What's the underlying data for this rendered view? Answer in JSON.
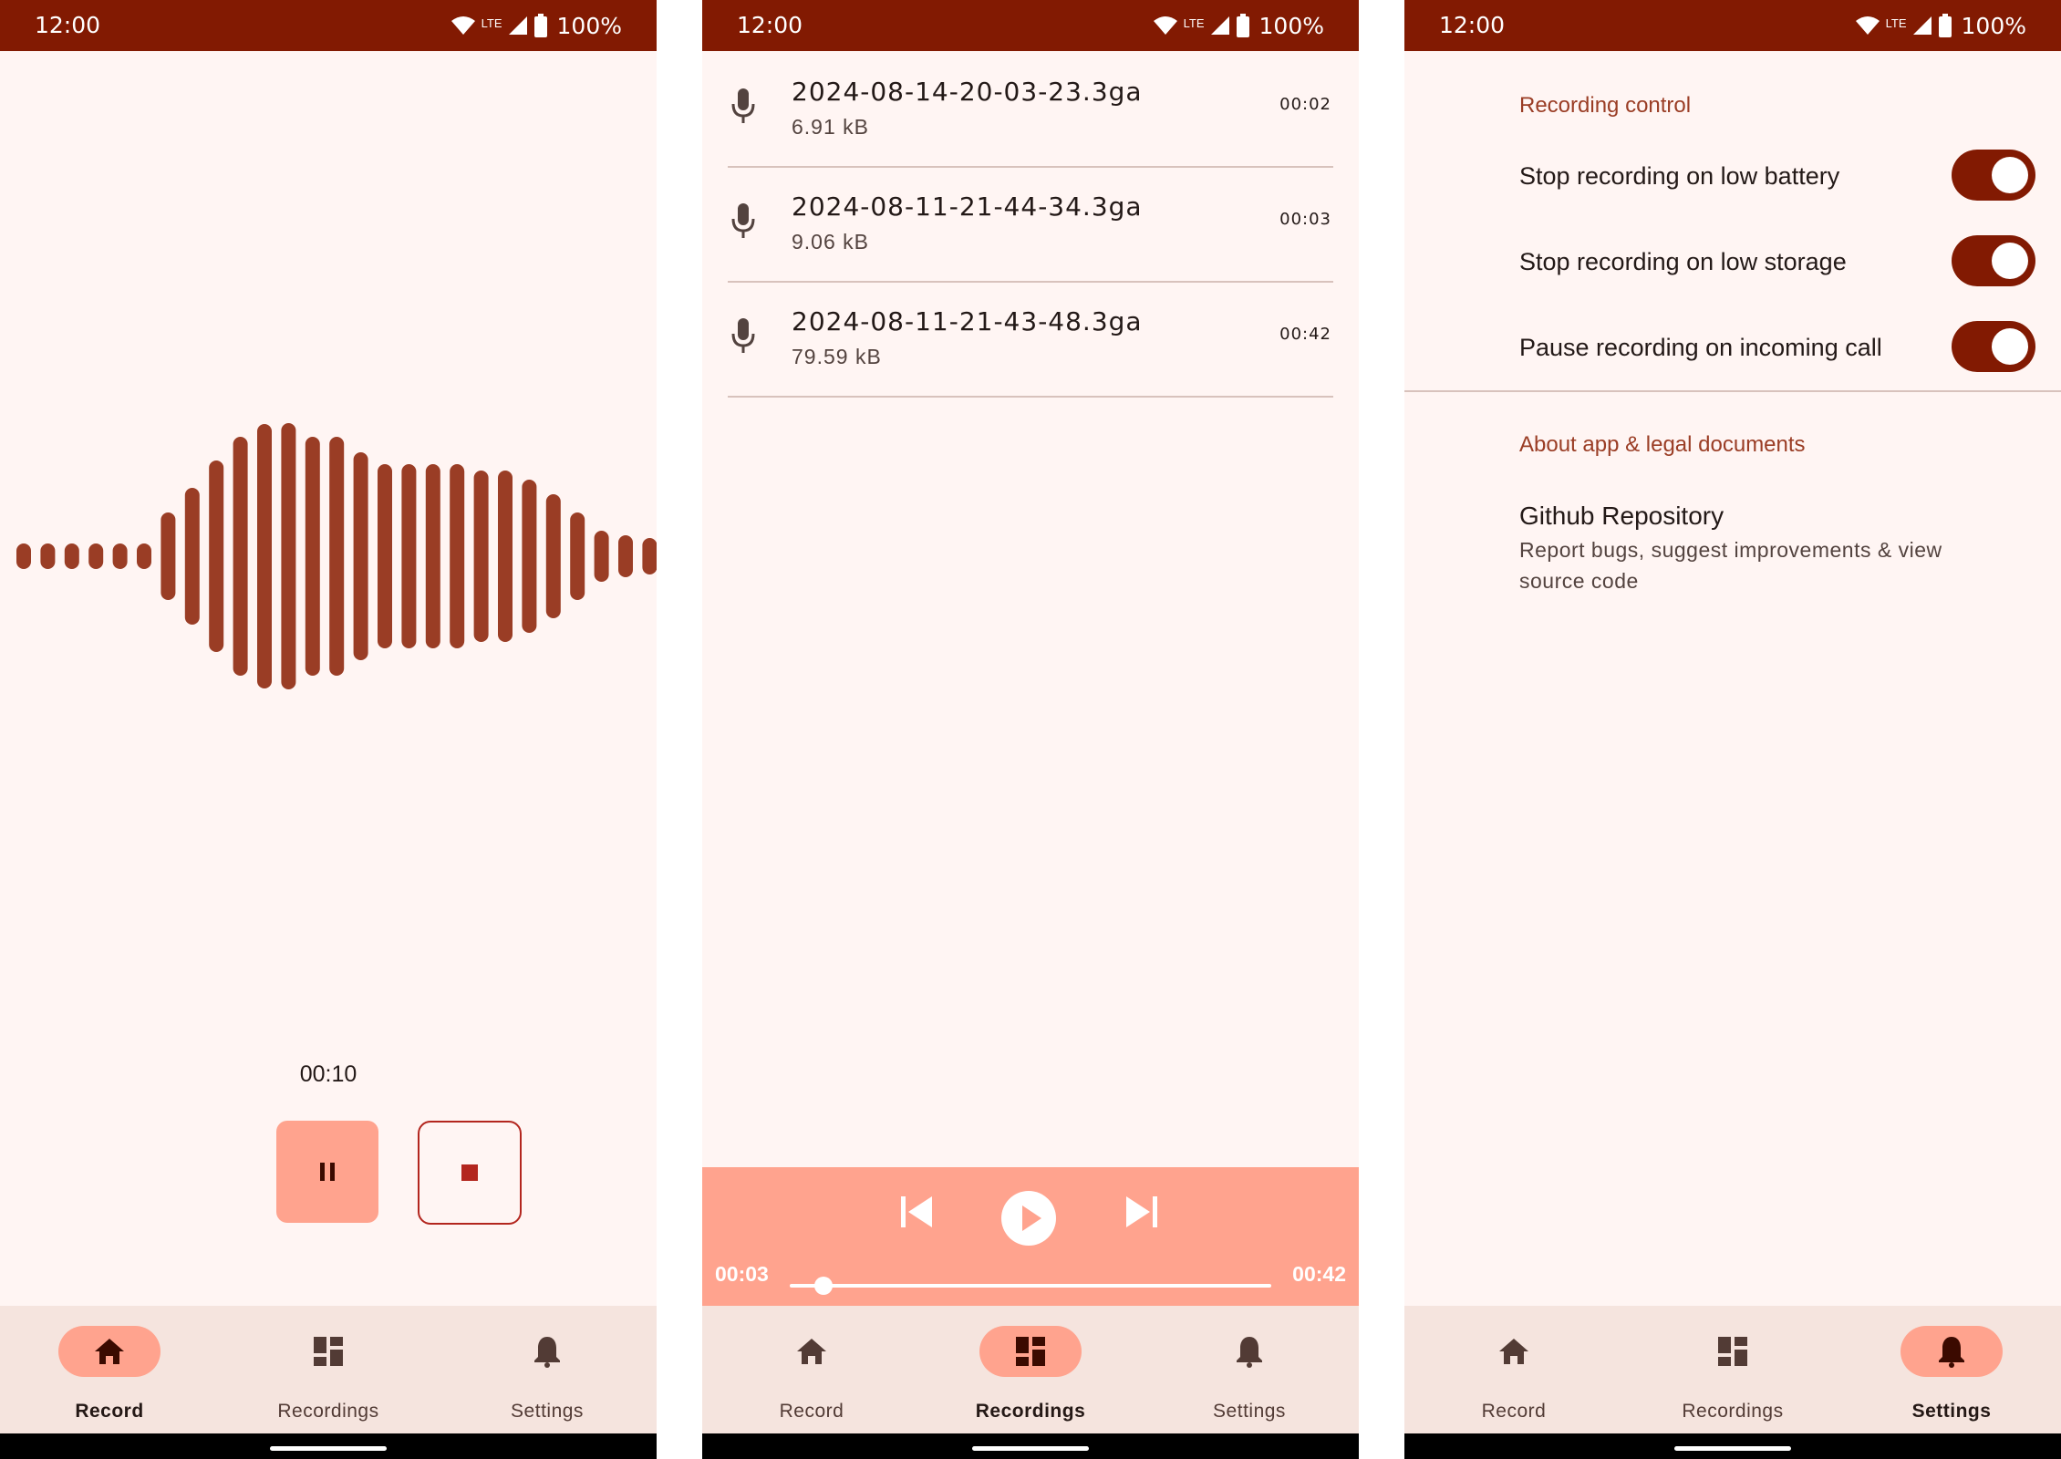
{
  "status_bar": {
    "time": "12:00",
    "network": "LTE",
    "battery": "100%"
  },
  "nav": {
    "record": "Record",
    "recordings": "Recordings",
    "settings": "Settings"
  },
  "record_screen": {
    "timer": "00:10"
  },
  "recordings_screen": {
    "items": [
      {
        "name": "2024-08-14-20-03-23.3ga",
        "size": "6.91 kB",
        "duration": "00:02"
      },
      {
        "name": "2024-08-11-21-44-34.3ga",
        "size": "9.06 kB",
        "duration": "00:03"
      },
      {
        "name": "2024-08-11-21-43-48.3ga",
        "size": "79.59 kB",
        "duration": "00:42"
      }
    ],
    "player": {
      "current": "00:03",
      "total": "00:42",
      "progress": 0.07
    }
  },
  "settings_screen": {
    "section_recording": "Recording control",
    "low_battery": "Stop recording on low battery",
    "low_storage": "Stop recording on low storage",
    "incoming_call": "Pause recording on incoming call",
    "section_about": "About app & legal documents",
    "github_title": "Github Repository",
    "github_sub": "Report bugs, suggest improvements & view source code",
    "toggles": {
      "low_battery": true,
      "low_storage": true,
      "incoming_call": true
    }
  },
  "colors": {
    "primary": "#821a02",
    "accent": "#ffa38e",
    "wave": "#9a3d25",
    "background": "#fff5f3",
    "nav_background": "#f5e4de"
  },
  "icons": {
    "record": "home-icon",
    "recordings": "dashboard-icon",
    "settings": "bell-icon",
    "pause": "pause-icon",
    "stop": "stop-icon",
    "mic": "mic-icon",
    "prev": "skip-previous-icon",
    "play": "play-circle-icon",
    "next": "skip-next-icon"
  }
}
